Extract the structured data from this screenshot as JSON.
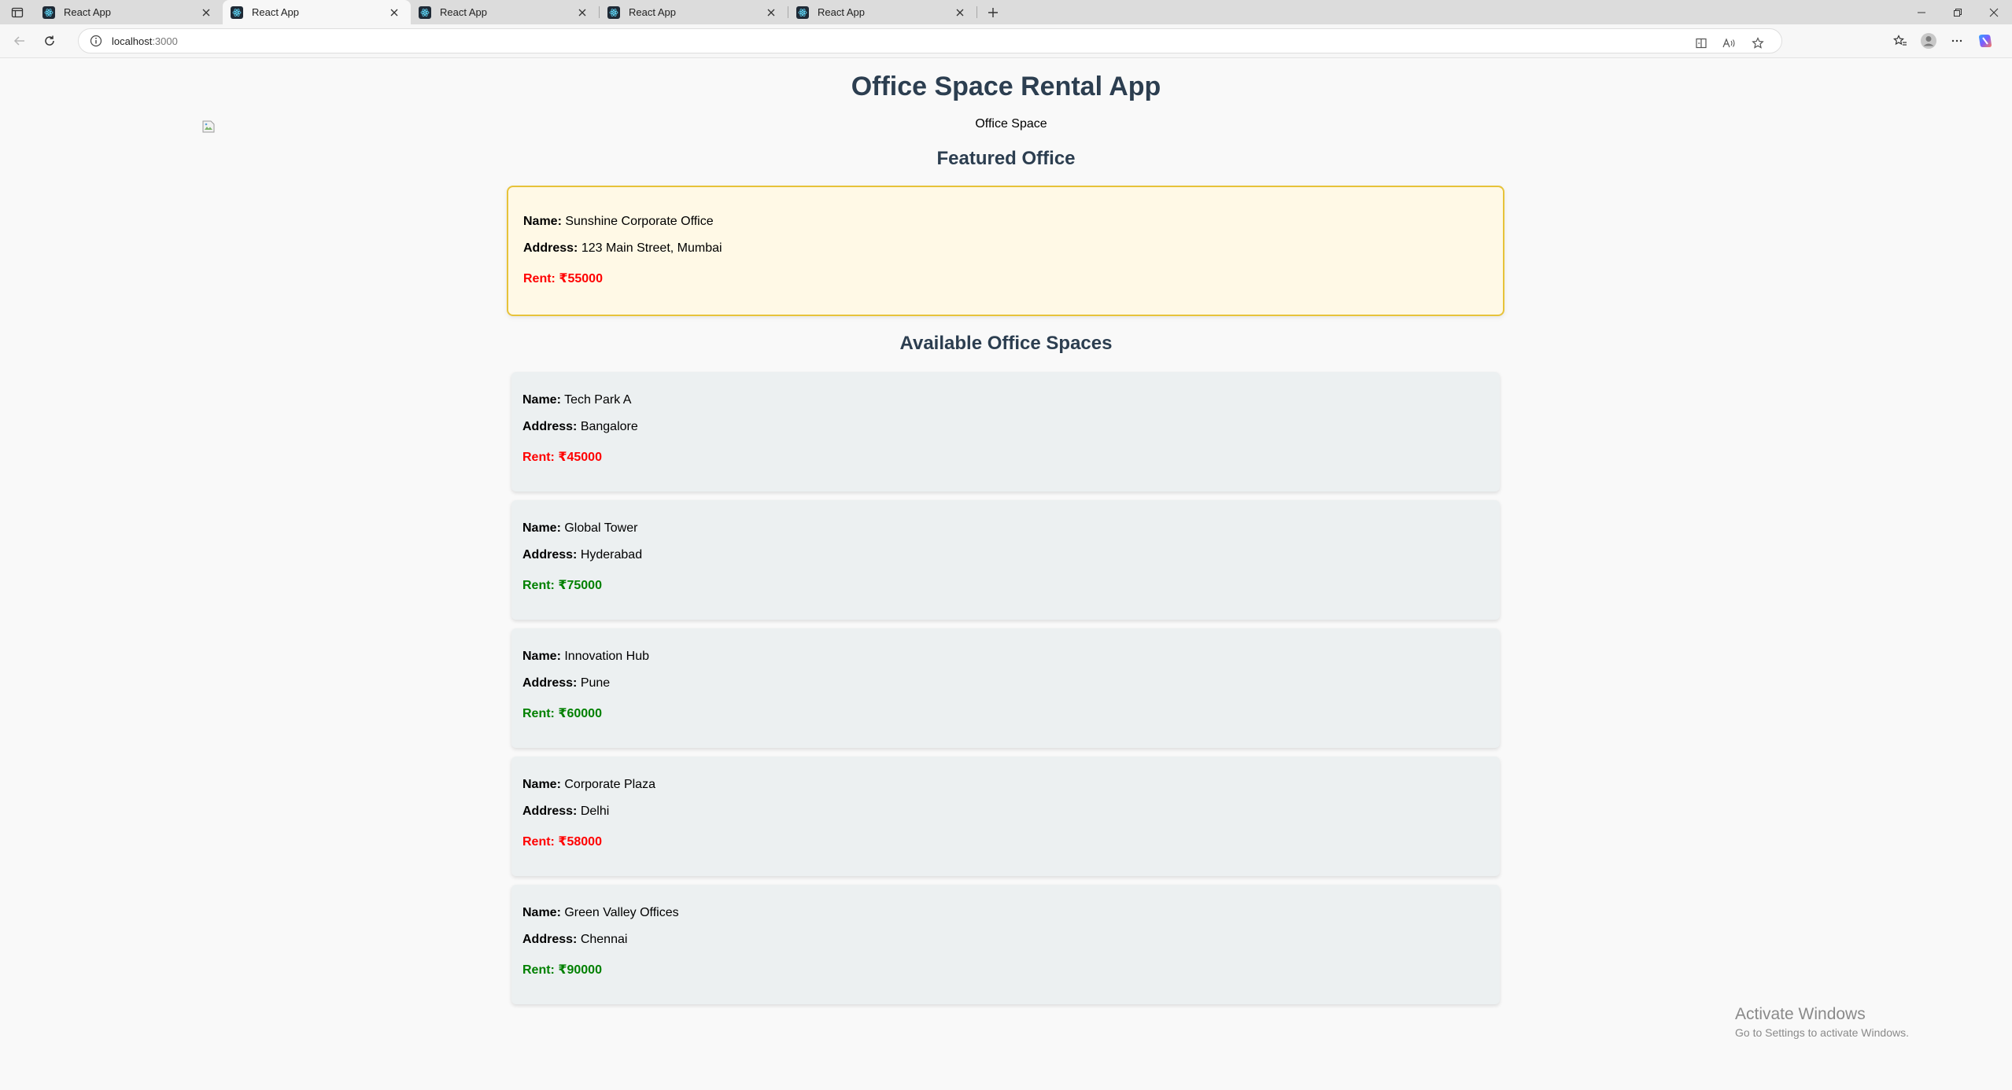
{
  "browser": {
    "tabs": [
      {
        "title": "React App",
        "active": false
      },
      {
        "title": "React App",
        "active": true
      },
      {
        "title": "React App",
        "active": false
      },
      {
        "title": "React App",
        "active": false
      },
      {
        "title": "React App",
        "active": false
      }
    ],
    "url_host": "localhost",
    "url_port": ":3000"
  },
  "page": {
    "title": "Office Space Rental App",
    "image_alt": "Office Space",
    "featured_heading": "Featured Office",
    "available_heading": "Available Office Spaces",
    "labels": {
      "name": "Name:",
      "address": "Address:",
      "rent": "Rent:"
    }
  },
  "featured": {
    "name": "Sunshine Corporate Office",
    "address": "123 Main Street, Mumbai",
    "rent": "₹55000",
    "rent_color": "#ff0000"
  },
  "offices": [
    {
      "name": "Tech Park A",
      "address": "Bangalore",
      "rent": "₹45000",
      "rent_color": "#ff0000"
    },
    {
      "name": "Global Tower",
      "address": "Hyderabad",
      "rent": "₹75000",
      "rent_color": "#008000"
    },
    {
      "name": "Innovation Hub",
      "address": "Pune",
      "rent": "₹60000",
      "rent_color": "#008000"
    },
    {
      "name": "Corporate Plaza",
      "address": "Delhi",
      "rent": "₹58000",
      "rent_color": "#ff0000"
    },
    {
      "name": "Green Valley Offices",
      "address": "Chennai",
      "rent": "₹90000",
      "rent_color": "#008000"
    }
  ],
  "watermark": {
    "line1": "Activate Windows",
    "line2": "Go to Settings to activate Windows."
  }
}
